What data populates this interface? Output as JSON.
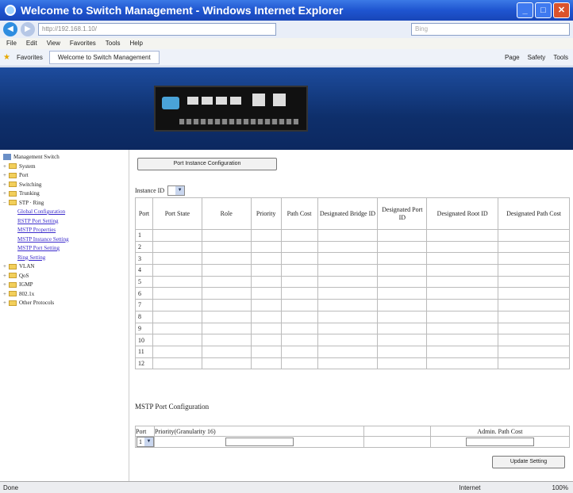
{
  "window": {
    "title": "Welcome to Switch Management - Windows Internet Explorer",
    "address": "http://192.168.1.10/",
    "search_placeholder": "Bing"
  },
  "menu": [
    "File",
    "Edit",
    "View",
    "Favorites",
    "Tools",
    "Help"
  ],
  "favorites": {
    "label": "Favorites",
    "tab_title": "Welcome to Switch Management",
    "tools": [
      "Page",
      "Safety",
      "Tools"
    ]
  },
  "sidebar": {
    "root": "Management Switch",
    "items": [
      {
        "label": "System"
      },
      {
        "label": "Port"
      },
      {
        "label": "Switching"
      },
      {
        "label": "Trunking"
      },
      {
        "label": "STP · Ring"
      },
      {
        "label": "VLAN"
      },
      {
        "label": "QoS"
      },
      {
        "label": "IGMP"
      },
      {
        "label": "802.1x"
      },
      {
        "label": "Other Protocols"
      }
    ],
    "stp_children": [
      "Global Configuration",
      "RSTP Port Setting",
      "MSTP Properties",
      "MSTP Instance Setting",
      "MSTP Port Setting",
      "Ring Setting"
    ]
  },
  "main": {
    "pic_button": "Port Instance Configuration",
    "instance_label": "Instance ID",
    "table_headers": [
      "Port",
      "Port State",
      "Role",
      "Priority",
      "Path Cost",
      "Designated Bridge ID",
      "Designated Port ID",
      "Designated Root ID",
      "Designated Path Cost"
    ],
    "ports": [
      "1",
      "2",
      "3",
      "4",
      "5",
      "6",
      "7",
      "8",
      "9",
      "10",
      "11",
      "12"
    ],
    "mstp_section": "MSTP Port Configuration",
    "cfg_headers": {
      "port": "Port",
      "priority": "Priority(Granularity 16)",
      "admin_cost": "Admin. Path Cost"
    },
    "port_select_value": "1",
    "update_button": "Update Setting"
  },
  "status": {
    "left": "Done",
    "zone": "Internet",
    "zoom": "100%"
  }
}
